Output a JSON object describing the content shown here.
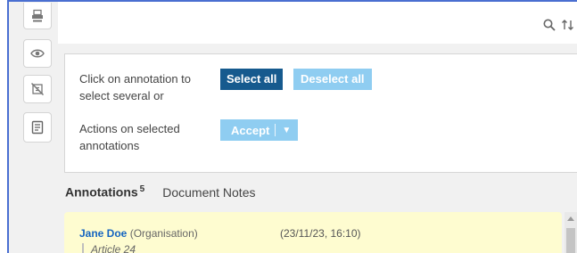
{
  "header": {
    "search_icon": "search-icon",
    "sort_icon": "sort-icon"
  },
  "toolbar": {
    "buttons": [
      {
        "icon": "stamp-icon"
      },
      {
        "icon": "eye-icon"
      },
      {
        "icon": "hide-annotations-icon"
      },
      {
        "icon": "notes-icon"
      }
    ]
  },
  "selection": {
    "instruction": "Click on annotation to select several or",
    "select_all_label": "Select all",
    "deselect_all_label": "Deselect all"
  },
  "actions": {
    "label": "Actions on selected annotations",
    "accept_label": "Accept",
    "dropdown_caret": "▼"
  },
  "tabs": {
    "annotations_label": "Annotations",
    "annotations_count": "5",
    "notes_label": "Document Notes"
  },
  "annotation": {
    "author": "Jane Doe",
    "organisation": "(Organisation)",
    "timestamp": "(23/11/23, 16:10)",
    "quote": "Article 24"
  },
  "colors": {
    "primary_dark": "#165a8e",
    "primary_light": "#8fcdf1",
    "note_background": "#fefcd0",
    "author_link": "#1565c0",
    "frame_border": "#4a6fd1"
  }
}
